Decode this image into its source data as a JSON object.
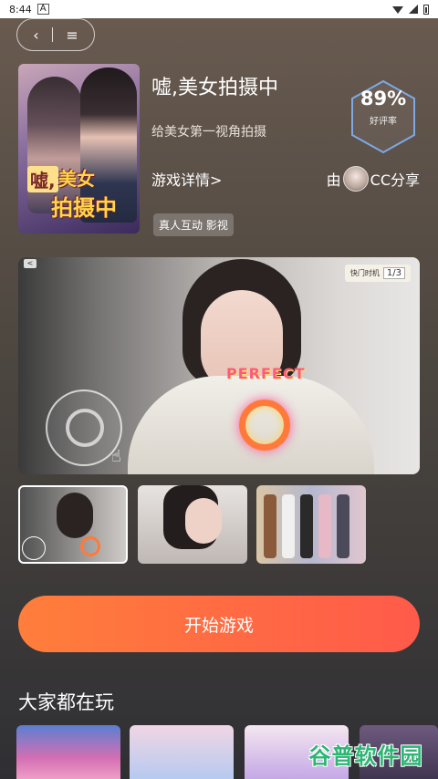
{
  "status_bar": {
    "time": "8:44",
    "notification_icon": "A"
  },
  "nav": {
    "back_glyph": "‹",
    "menu_glyph": "≡"
  },
  "cover": {
    "title_part1": "嘘,",
    "title_part2": "美女",
    "title_part3": "拍摄中"
  },
  "game": {
    "title": "嘘,美女拍摄中",
    "subtitle": "给美女第一视角拍摄",
    "details_link": "游戏详情>",
    "tag": "真人互动 影视",
    "rating": "89%",
    "rating_label": "好评率",
    "author_prefix": "由",
    "author_suffix": "CC分享"
  },
  "preview": {
    "back_glyph": "<",
    "counter_label": "快门时机",
    "counter_value": "1/3",
    "perfect_text": "PERFECT"
  },
  "thumbnails_count": 3,
  "actions": {
    "start_label": "开始游戏"
  },
  "section": {
    "title": "大家都在玩"
  },
  "watermark": {
    "text": "谷普软件园"
  },
  "colors": {
    "accent_start": "#ff7e3b",
    "accent_end": "#ff5a4a",
    "rating_border": "#7ea8e6"
  }
}
